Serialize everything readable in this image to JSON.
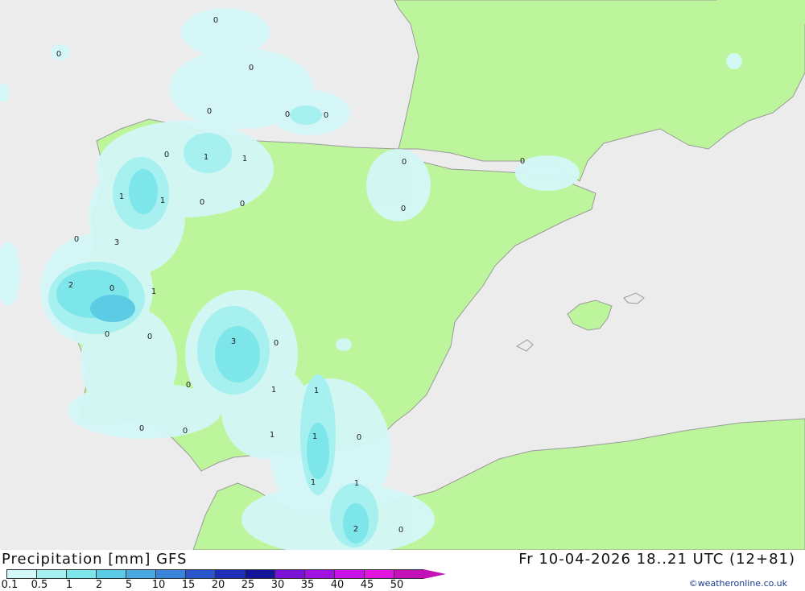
{
  "header": {
    "title": "Precipitation [mm] GFS",
    "datetime": "Fr 10-04-2026 18..21 UTC (12+81)",
    "credit": "©weatheronline.co.uk"
  },
  "legend": {
    "ticks": [
      "0.1",
      "0.5",
      "1",
      "2",
      "5",
      "10",
      "15",
      "20",
      "25",
      "30",
      "35",
      "40",
      "45",
      "50"
    ],
    "colors": [
      "#d4f7f7",
      "#a6f0f0",
      "#7ce6ea",
      "#5ccbe4",
      "#4aa8e0",
      "#3a84da",
      "#2b55cc",
      "#1f2fb8",
      "#14149a",
      "#7a12d8",
      "#a012e0",
      "#c812e8",
      "#e214e0",
      "#c412b8"
    ]
  },
  "colors": {
    "sea": "#ececec",
    "land": "#bdf59c",
    "border": "#9a9a9a",
    "precip_light": "#d4f7f7",
    "precip_1": "#a6f0f0",
    "precip_2": "#7ce6ea",
    "precip_3": "#5ccbe4"
  },
  "map_labels": [
    "0",
    "0",
    "0",
    "0",
    "0",
    "0",
    "1",
    "1",
    "0",
    "1",
    "1",
    "0",
    "0",
    "0",
    "0",
    "0",
    "0",
    "3",
    "2",
    "0",
    "1",
    "0",
    "3",
    "0",
    "0",
    "1",
    "1",
    "0",
    "1",
    "1",
    "0",
    "1",
    "1",
    "0",
    "0",
    "2",
    "0"
  ]
}
